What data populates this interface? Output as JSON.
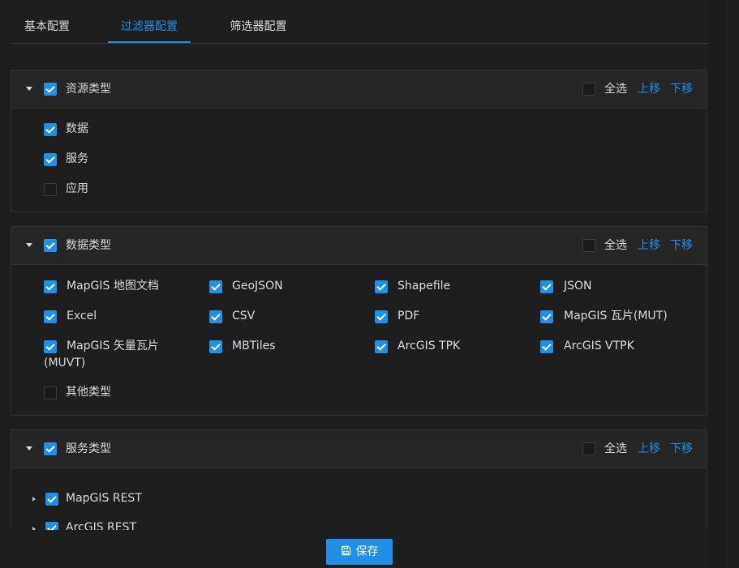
{
  "tabs": [
    {
      "label": "基本配置"
    },
    {
      "label": "过滤器配置"
    },
    {
      "label": "筛选器配置"
    }
  ],
  "active_tab": "过滤器配置",
  "panels": {
    "resource": {
      "title": "资源类型",
      "select_all": "全选",
      "move_up": "上移",
      "move_down": "下移",
      "items": [
        {
          "label": "数据",
          "checked": true
        },
        {
          "label": "服务",
          "checked": true
        },
        {
          "label": "应用",
          "checked": false
        }
      ]
    },
    "data": {
      "title": "数据类型",
      "select_all": "全选",
      "move_up": "上移",
      "move_down": "下移",
      "items": [
        {
          "label": "MapGIS 地图文档",
          "checked": true
        },
        {
          "label": "GeoJSON",
          "checked": true
        },
        {
          "label": "Shapefile",
          "checked": true
        },
        {
          "label": "JSON",
          "checked": true
        },
        {
          "label": "Excel",
          "checked": true
        },
        {
          "label": "CSV",
          "checked": true
        },
        {
          "label": "PDF",
          "checked": true
        },
        {
          "label": "MapGIS 瓦片(MUT)",
          "checked": true
        },
        {
          "label": "MapGIS 矢量瓦片",
          "label_cont": "(MUVT)",
          "checked": true
        },
        {
          "label": "MBTiles",
          "checked": true
        },
        {
          "label": "ArcGIS TPK",
          "checked": true
        },
        {
          "label": "ArcGIS VTPK",
          "checked": true
        },
        {
          "label": "其他类型",
          "checked": false
        }
      ]
    },
    "service": {
      "title": "服务类型",
      "select_all": "全选",
      "move_up": "上移",
      "move_down": "下移",
      "items": [
        {
          "label": "MapGIS REST",
          "checked": true
        },
        {
          "label": "ArcGIS REST",
          "checked": true
        }
      ]
    }
  },
  "save_button": "保存",
  "colors": {
    "accent": "#1f8fe8",
    "background": "#1e1e1e",
    "header": "#262626",
    "text": "#d9d9d9"
  }
}
